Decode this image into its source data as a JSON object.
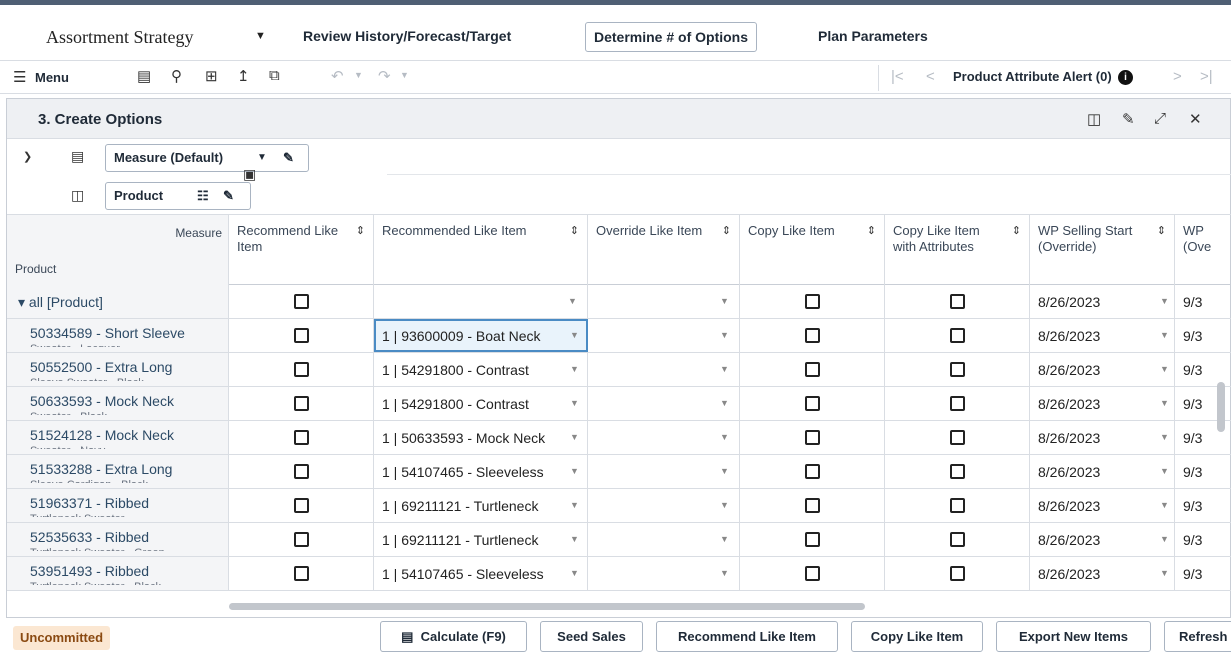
{
  "app": {
    "title": "Assortment Strategy",
    "tabs": [
      {
        "label": "Review History/Forecast/Target"
      },
      {
        "label": "Determine # of Options",
        "selected": true
      },
      {
        "label": "Plan Parameters"
      }
    ]
  },
  "toolbar": {
    "menu_label": "Menu",
    "alert_label": "Product Attribute Alert (0)"
  },
  "panel": {
    "title": "3. Create Options",
    "measure_chip": "Measure (Default)",
    "product_chip": "Product"
  },
  "grid": {
    "corner_measure": "Measure",
    "corner_product": "Product",
    "columns": [
      {
        "label": "Recommend Like Item"
      },
      {
        "label": "Recommended Like Item"
      },
      {
        "label": "Override Like Item"
      },
      {
        "label": "Copy Like Item"
      },
      {
        "label": "Copy Like Item with Attributes"
      },
      {
        "label": "WP Selling Start (Override)"
      },
      {
        "label": "WP (Ove"
      }
    ],
    "rows": [
      {
        "label": "all [Product]",
        "sub": "",
        "rec_like": "",
        "wp_start": "8/26/2023",
        "wp_next": "9/3"
      },
      {
        "label": "50334589 - Short Sleeve",
        "sub": "Sweater - Lacquer",
        "rec_like": "1 | 93600009 - Boat Neck",
        "wp_start": "8/26/2023",
        "wp_next": "9/3"
      },
      {
        "label": "50552500 - Extra Long",
        "sub": "Sleeve Sweater - Black",
        "rec_like": "1 | 54291800 - Contrast",
        "wp_start": "8/26/2023",
        "wp_next": "9/3"
      },
      {
        "label": "50633593 - Mock Neck",
        "sub": "Sweater - Black",
        "rec_like": "1 | 54291800 - Contrast",
        "wp_start": "8/26/2023",
        "wp_next": "9/3"
      },
      {
        "label": "51524128 - Mock Neck",
        "sub": "Sweater - Navy",
        "rec_like": "1 | 50633593 - Mock Neck",
        "wp_start": "8/26/2023",
        "wp_next": "9/3"
      },
      {
        "label": "51533288 - Extra Long",
        "sub": "Sleeve Cardigan - Black",
        "rec_like": "1 | 54107465 - Sleeveless",
        "wp_start": "8/26/2023",
        "wp_next": "9/3"
      },
      {
        "label": "51963371 - Ribbed",
        "sub": "Turtleneck Sweater",
        "rec_like": "1 | 69211121 - Turtleneck",
        "wp_start": "8/26/2023",
        "wp_next": "9/3"
      },
      {
        "label": "52535633 - Ribbed",
        "sub": "Turtleneck Sweater - Green",
        "rec_like": "1 | 69211121 - Turtleneck",
        "wp_start": "8/26/2023",
        "wp_next": "9/3"
      },
      {
        "label": "53951493 - Ribbed",
        "sub": "Turtleneck Sweater - Black",
        "rec_like": "1 | 54107465 - Sleeveless",
        "wp_start": "8/26/2023",
        "wp_next": "9/3"
      }
    ]
  },
  "footer": {
    "status": "Uncommitted",
    "buttons": [
      {
        "label": "Calculate (F9)"
      },
      {
        "label": "Seed Sales"
      },
      {
        "label": "Recommend Like Item"
      },
      {
        "label": "Copy Like Item"
      },
      {
        "label": "Export New Items"
      },
      {
        "label": "Refresh"
      }
    ]
  }
}
